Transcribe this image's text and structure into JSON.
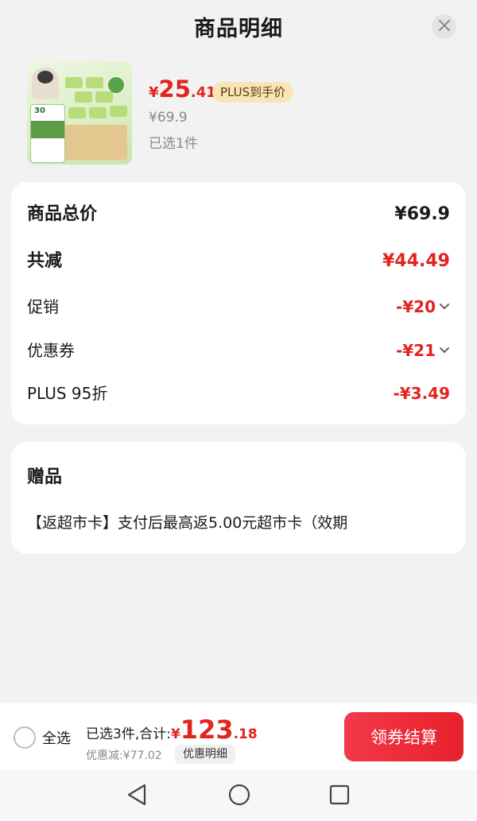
{
  "header": {
    "title": "商品明细"
  },
  "product": {
    "price_symbol": "¥",
    "price_int": "25",
    "price_dec": ".41",
    "plus_tag": "PLUS到手价",
    "original_price": "¥69.9",
    "selected_count": "已选1件",
    "image_number": "30"
  },
  "breakdown": {
    "total_label": "商品总价",
    "total_value": "¥69.9",
    "reduction_label": "共减",
    "reduction_value": "¥44.49",
    "promo_label": "促销",
    "promo_value": "-¥20",
    "coupon_label": "优惠券",
    "coupon_value": "-¥21",
    "plus_label": "PLUS 95折",
    "plus_value": "-¥3.49"
  },
  "gift": {
    "title": "赠品",
    "text": "【返超市卡】支付后最高返5.00元超市卡（效期"
  },
  "bottom": {
    "select_all": "全选",
    "summary_text": "已选3件,合计:",
    "total_symbol": "¥",
    "total_int": "123",
    "total_dec": ".18",
    "discount_text": "优惠减:¥77.02",
    "detail_button": "优惠明细",
    "checkout_button": "领券结算"
  },
  "colors": {
    "accent": "#e3231d",
    "plus_tag_bg": "#f7e6b3"
  },
  "icons": [
    "close-icon",
    "chevron-down-icon",
    "radio-icon",
    "nav-back-icon",
    "nav-home-icon",
    "nav-recent-icon"
  ]
}
